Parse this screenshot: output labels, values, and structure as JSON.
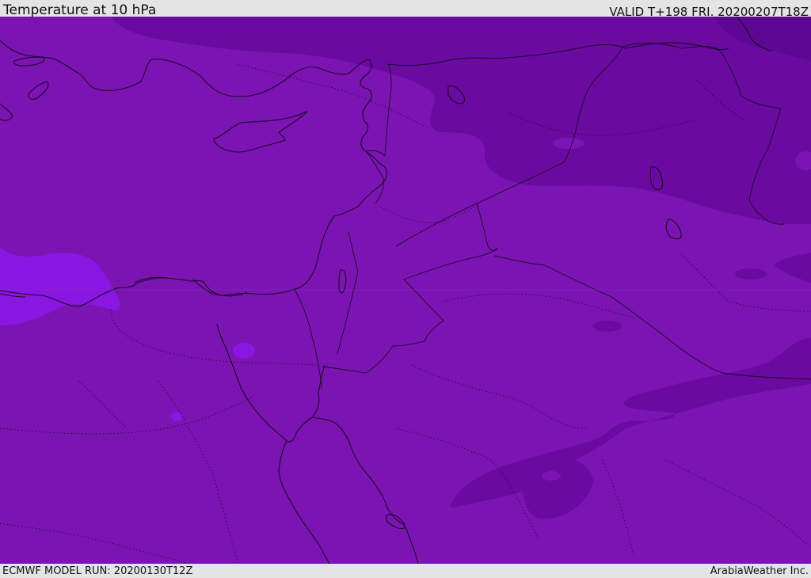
{
  "header": {
    "title": "Temperature at 10 hPa",
    "valid": "VALID T+198 FRI. 20200207T18Z"
  },
  "footer": {
    "model_run": "ECMWF MODEL RUN: 20200130T12Z",
    "credit": "ArabiaWeather Inc."
  },
  "map": {
    "region": "Eastern Mediterranean / Middle East",
    "colors": {
      "base": "#7b14b3",
      "cold": "#6a0aa0",
      "coldest": "#5a0890",
      "warm": "#8a1ee0",
      "coastline": "#1a0a24"
    }
  }
}
